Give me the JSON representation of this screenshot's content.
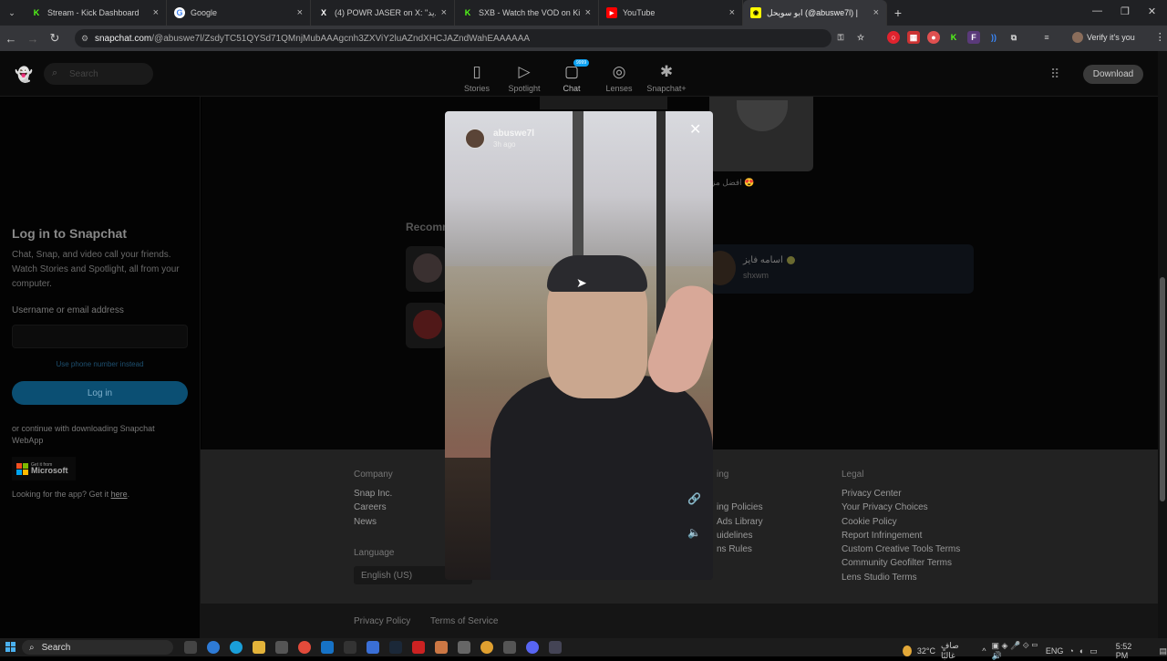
{
  "browser": {
    "tabs": [
      {
        "title": "Stream - Kick Dashboard",
        "fav": "K",
        "fav_color": "#53fc18"
      },
      {
        "title": "Google",
        "fav": "G",
        "fav_color": "#ffffff"
      },
      {
        "title": "(4) POWR JASER on X: \"م الجديد",
        "fav": "X",
        "fav_color": "#000000"
      },
      {
        "title": "SXB - Watch the VOD on Kick",
        "fav": "K",
        "fav_color": "#53fc18"
      },
      {
        "title": "YouTube",
        "fav": "▶",
        "fav_color": "#ff0000"
      },
      {
        "title": "ابو سويحل (@abuswe7l) |",
        "fav": "👻",
        "fav_color": "#fffc00"
      }
    ],
    "url_domain": "snapchat.com",
    "url_path": "/@abuswe7l/ZsdyTC51QYSd71QMnjMubAAAgcnh3ZXViY2luAZndXHCJAZndWahEAAAAAA",
    "verify_label": "Verify it's you"
  },
  "header": {
    "search_placeholder": "Search",
    "nav": [
      {
        "label": "Stories",
        "icon": "stories-icon",
        "glyph": "▯"
      },
      {
        "label": "Spotlight",
        "icon": "spotlight-icon",
        "glyph": "▷"
      },
      {
        "label": "Chat",
        "icon": "chat-icon",
        "glyph": "▢",
        "badge": "9999"
      },
      {
        "label": "Lenses",
        "icon": "lenses-icon",
        "glyph": "◎"
      },
      {
        "label": "Snapchat+",
        "icon": "snapchat-plus-icon",
        "glyph": "✱"
      }
    ],
    "download_label": "Download"
  },
  "login": {
    "title": "Log in to Snapchat",
    "description": "Chat, Snap, and video call your friends. Watch Stories and Spotlight, all from your computer.",
    "username_label": "Username or email address",
    "phone_link": "Use phone number instead",
    "login_button": "Log in",
    "continue_text": "or continue with downloading Snapchat WebApp",
    "ms_get": "Get it from",
    "ms_name": "Microsoft",
    "looking_prefix": "Looking for the app? Get it ",
    "looking_link": "here",
    "looking_suffix": "."
  },
  "content": {
    "arabic_caption": "افضل مز 😍",
    "recommended_heading": "Recomm",
    "rec_name": "اسامه فايز",
    "rec_handle": "shxwm"
  },
  "modal": {
    "username": "abuswe7l",
    "time": "3h ago"
  },
  "footer": {
    "company_heading": "Company",
    "company_links": [
      "Snap Inc.",
      "Careers",
      "News"
    ],
    "middle_heading": "ing",
    "middle_links": [
      "ing Policies",
      "Ads Library",
      "uidelines",
      "ns Rules"
    ],
    "legal_heading": "Legal",
    "legal_links": [
      "Privacy Center",
      "Your Privacy Choices",
      "Cookie Policy",
      "Report Infringement",
      "Custom Creative Tools Terms",
      "Community Geofilter Terms",
      "Lens Studio Terms"
    ],
    "language_label": "Language",
    "language_value": "English (US)",
    "privacy_policy": "Privacy Policy",
    "terms": "Terms of Service"
  },
  "taskbar": {
    "search": "Search",
    "temp": "32°C",
    "weather": "صافٍ غالبًا",
    "lang": "ENG",
    "time": "5:52 PM"
  }
}
